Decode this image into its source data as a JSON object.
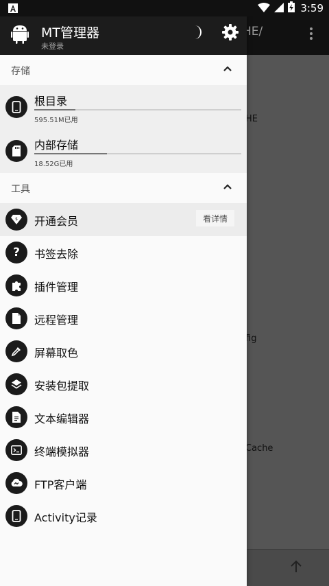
{
  "status_bar": {
    "time": "3:59",
    "notification_icon": "a-notification-icon"
  },
  "drawer": {
    "title": "MT管理器",
    "subtitle": "未登录",
    "sections": {
      "storage": {
        "label": "存储"
      },
      "tools": {
        "label": "工具"
      }
    },
    "storage_items": [
      {
        "label": "根目录",
        "size": "595.51M已用",
        "fill_fraction": 0.2,
        "icon": "phone-icon"
      },
      {
        "label": "内部存储",
        "size": "18.52G已用",
        "fill_fraction": 0.35,
        "icon": "sd-card-icon"
      }
    ],
    "tool_items": [
      {
        "label": "开通会员",
        "icon": "diamond-icon",
        "detail": "看详情"
      },
      {
        "label": "书签去除",
        "icon": "help-icon"
      },
      {
        "label": "插件管理",
        "icon": "puzzle-icon"
      },
      {
        "label": "远程管理",
        "icon": "file-icon"
      },
      {
        "label": "屏幕取色",
        "icon": "eyedropper-icon"
      },
      {
        "label": "安装包提取",
        "icon": "layers-icon"
      },
      {
        "label": "文本编辑器",
        "icon": "document-icon"
      },
      {
        "label": "终端模拟器",
        "icon": "terminal-icon"
      },
      {
        "label": "FTP客户端",
        "icon": "ftp-cloud-icon"
      },
      {
        "label": "Activity记录",
        "icon": "phone-icon"
      }
    ]
  },
  "background": {
    "path": "HE/",
    "rows": [
      "HE",
      "fig",
      "Cache"
    ]
  },
  "colors": {
    "header": "#1c1c1c",
    "drawer_bg": "#fafafa",
    "icon_bg": "#1b1b1b"
  }
}
